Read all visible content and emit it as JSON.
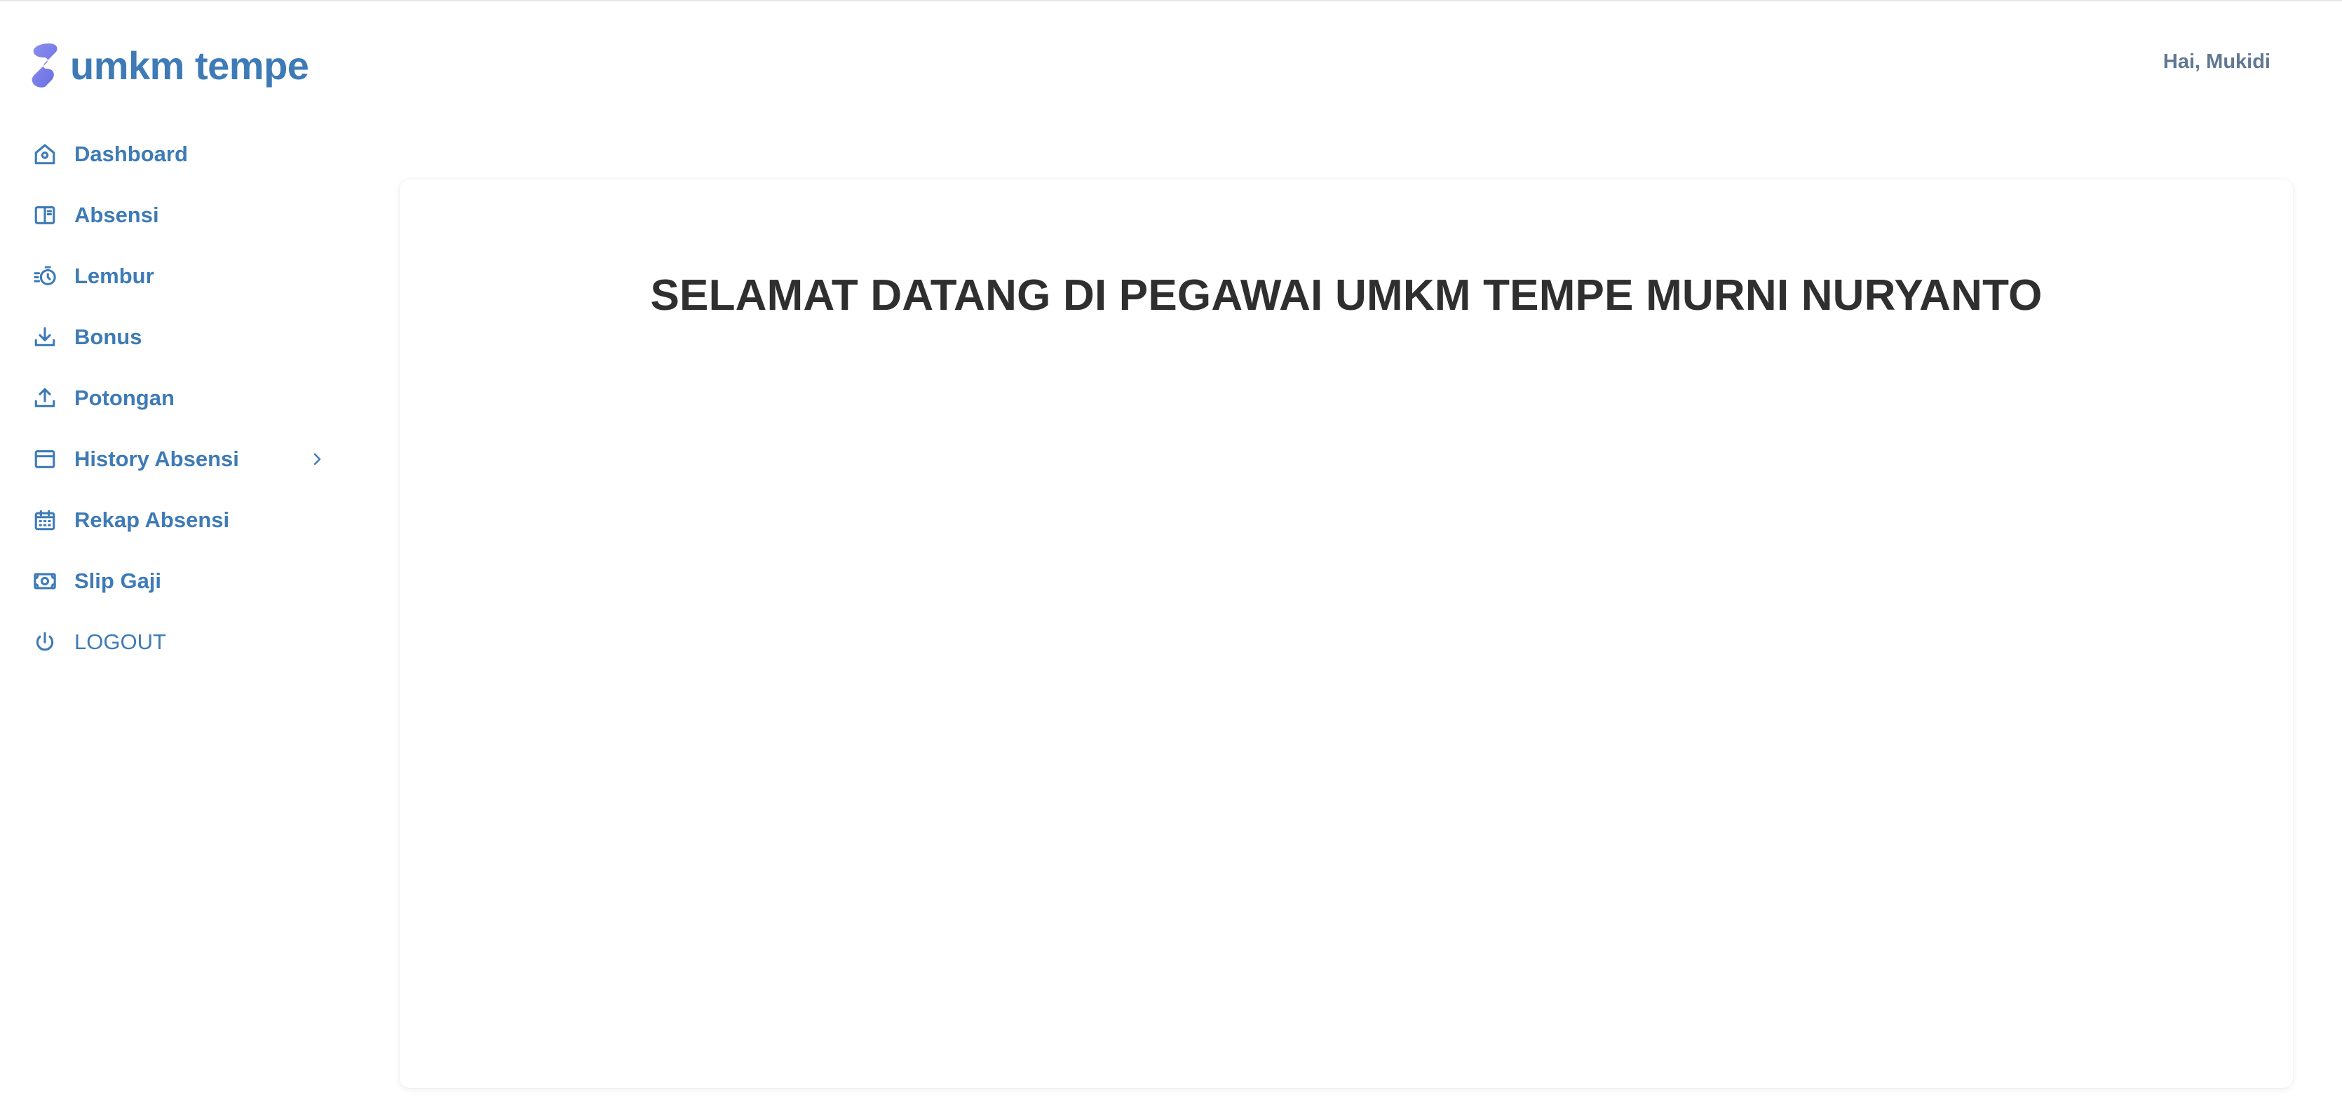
{
  "brand": {
    "name": "umkm tempe",
    "logo_icon": "s-logo-icon",
    "logo_color": "#7b7fe8"
  },
  "header": {
    "greeting": "Hai, Mukidi"
  },
  "sidebar": {
    "items": [
      {
        "label": "Dashboard",
        "icon": "home-icon"
      },
      {
        "label": "Absensi",
        "icon": "book-open-icon"
      },
      {
        "label": "Lembur",
        "icon": "stopwatch-icon"
      },
      {
        "label": "Bonus",
        "icon": "download-icon"
      },
      {
        "label": "Potongan",
        "icon": "upload-icon"
      },
      {
        "label": "History Absensi",
        "icon": "window-icon",
        "has_submenu": true
      },
      {
        "label": "Rekap Absensi",
        "icon": "calendar-icon"
      },
      {
        "label": "Slip Gaji",
        "icon": "money-icon"
      },
      {
        "label": "LOGOUT",
        "icon": "power-icon"
      }
    ]
  },
  "main": {
    "welcome_title": "SELAMAT DATANG DI PEGAWAI UMKM TEMPE MURNI NURYANTO"
  },
  "colors": {
    "accent": "#3e7bb6",
    "greeting": "#5f7893",
    "title": "#2f2f2f"
  }
}
